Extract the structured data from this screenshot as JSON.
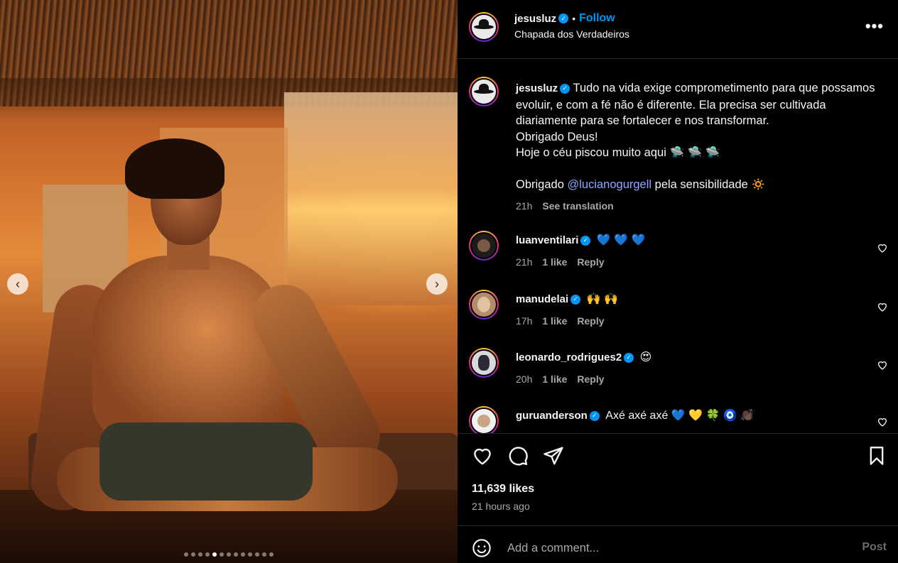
{
  "post": {
    "author": "jesusluz",
    "follow_label": "Follow",
    "separator": "•",
    "location": "Chapada dos Verdadeiros",
    "more_icon": "more-options-icon",
    "caption_lines": [
      "Tudo na vida exige comprometimento para que possamos evoluir, e com a fé não é diferente. Ela precisa ser cultivada diariamente para se fortalecer e nos transformar.",
      "Obrigado Deus!",
      "Hoje o céu piscou muito aqui 🛸 🛸 🛸"
    ],
    "thanks_prefix": "Obrigado",
    "thanks_mention": "@lucianogurgell",
    "thanks_suffix": "pela sensibilidade 🔅",
    "caption_time": "21h",
    "see_translation": "See translation",
    "likes": "11,639 likes",
    "time_ago": "21 hours ago"
  },
  "carousel": {
    "prev_label": "‹",
    "next_label": "›",
    "total_slides": 13,
    "active_slide": 5
  },
  "comments": [
    {
      "user": "luanventilari",
      "text": "💙 💙 💙",
      "time": "21h",
      "likes": "1 like",
      "reply": "Reply"
    },
    {
      "user": "manudelai",
      "text": "🙌 🙌",
      "time": "17h",
      "likes": "1 like",
      "reply": "Reply"
    },
    {
      "user": "leonardo_rodrigues2",
      "text": "😍",
      "time": "20h",
      "likes": "1 like",
      "reply": "Reply"
    },
    {
      "user": "guruanderson",
      "text": "Axé axé axé 💙 💛 🍀 🧿 👏🏿",
      "time": "",
      "likes": "",
      "reply": ""
    }
  ],
  "composer": {
    "placeholder": "Add a comment...",
    "post_label": "Post"
  },
  "colors": {
    "accent": "#0095f6",
    "mention": "#8ea8ff",
    "muted": "#a8a8a8"
  }
}
